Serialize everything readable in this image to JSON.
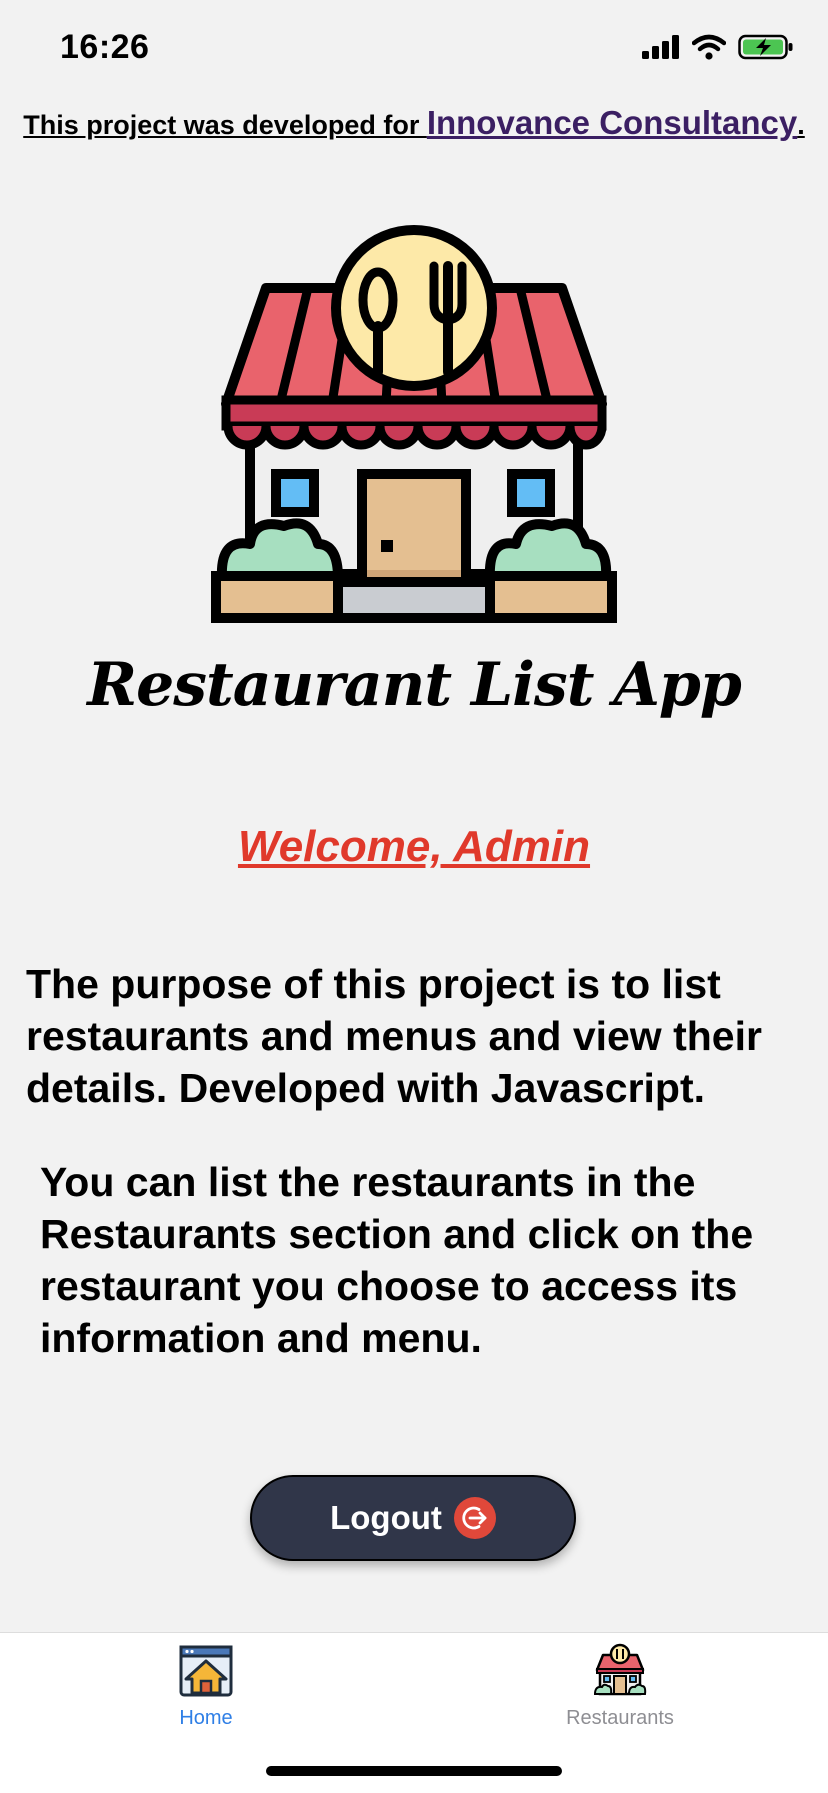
{
  "status_bar": {
    "time": "16:26",
    "icons": [
      "signal-icon",
      "wifi-icon",
      "battery-charging-icon"
    ]
  },
  "credit": {
    "prefix": "This project was developed for ",
    "link_text": "Innovance Consultancy",
    "suffix": ".",
    "link_color": "#3b1f63"
  },
  "hero_image": {
    "icon": "restaurant-icon"
  },
  "app_title": "Restaurant List App",
  "welcome": {
    "text": "Welcome, Admin",
    "color": "#e0392b"
  },
  "description": [
    "The purpose of this project is to list restaurants and menus and view their details. Developed with Javascript.",
    "You can list the restaurants in the Restaurants section and click on the restaurant you choose to access its information and menu."
  ],
  "logout_button": {
    "label": "Logout",
    "icon": "logout-icon",
    "color": "#303649",
    "icon_color": "#e0483a"
  },
  "tab_bar": {
    "active_color": "#2f7fe6",
    "inactive_color": "#8e8e93",
    "tabs": [
      {
        "label": "Home",
        "icon": "home-icon",
        "active": true
      },
      {
        "label": "Restaurants",
        "icon": "restaurant-icon",
        "active": false
      }
    ]
  }
}
